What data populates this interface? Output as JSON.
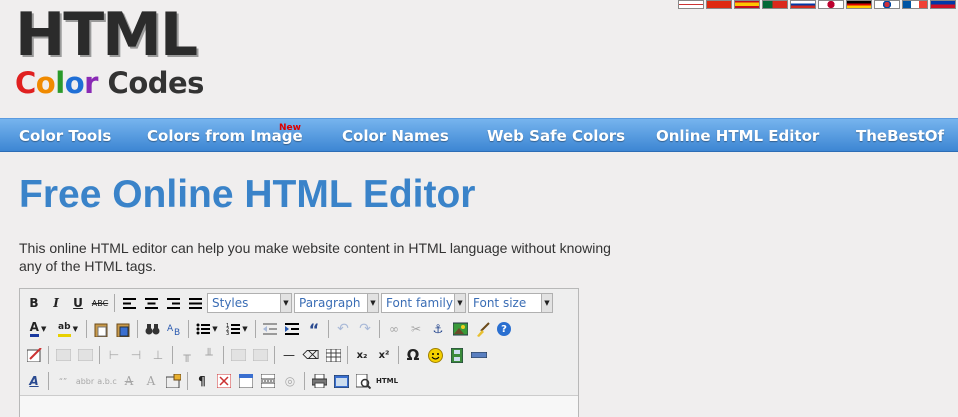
{
  "logo": {
    "title": "HTML",
    "subtitle_letters": [
      {
        "ch": "C",
        "color": "#e02020"
      },
      {
        "ch": "o",
        "color": "#f08a00"
      },
      {
        "ch": "l",
        "color": "#2a9a2a"
      },
      {
        "ch": "o",
        "color": "#1f6fd6"
      },
      {
        "ch": "r",
        "color": "#8a2ab5"
      },
      {
        "ch": " Codes",
        "color": "#333333"
      }
    ]
  },
  "flags": [
    "uk-flag",
    "china-flag",
    "spain-flag",
    "portugal-flag",
    "russia-flag",
    "japan-flag",
    "germany-flag",
    "korea-flag",
    "france-flag",
    "philippines-flag"
  ],
  "nav": {
    "items": [
      "Color Tools",
      "Colors from Image",
      "Color Names",
      "Web Safe Colors",
      "Online HTML Editor",
      "TheBestOf"
    ],
    "new_badge": "New"
  },
  "page": {
    "title": "Free Online HTML Editor",
    "intro": "This online HTML editor can help you make website content in HTML language without knowing any of the HTML tags."
  },
  "editor": {
    "selects": {
      "styles": "Styles",
      "paragraph": "Paragraph",
      "font_family": "Font family",
      "font_size": "Font size"
    },
    "icons": {
      "bold": "B",
      "italic": "I",
      "underline": "U",
      "strikethrough": "ABC",
      "html": "HTML",
      "omega": "Ω",
      "quote": "“",
      "anchor": "⚓",
      "help": "?",
      "hr": "—",
      "pilcrow": "¶",
      "subscript": "x₂",
      "superscript": "x²"
    }
  }
}
